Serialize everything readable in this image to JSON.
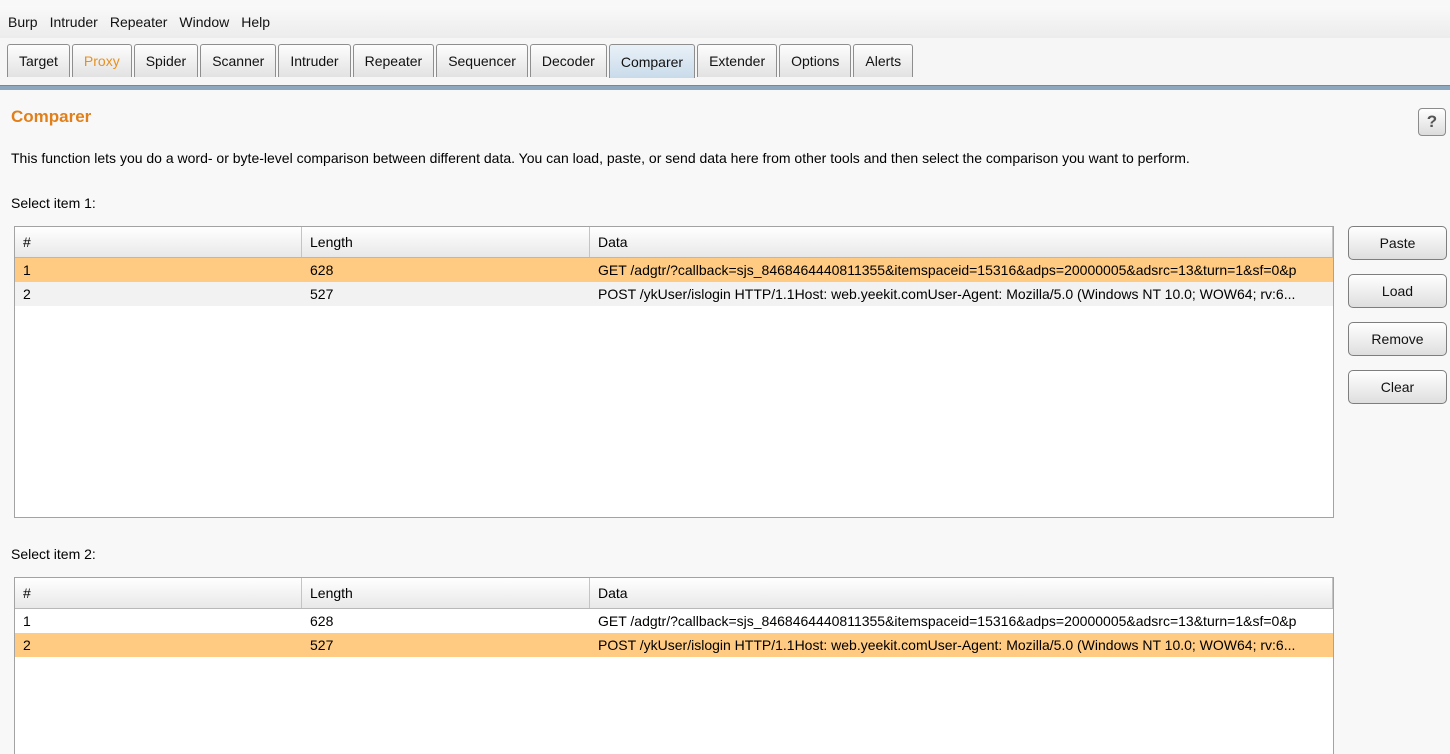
{
  "menu": [
    "Burp",
    "Intruder",
    "Repeater",
    "Window",
    "Help"
  ],
  "tabs": [
    "Target",
    "Proxy",
    "Spider",
    "Scanner",
    "Intruder",
    "Repeater",
    "Sequencer",
    "Decoder",
    "Comparer",
    "Extender",
    "Options",
    "Alerts"
  ],
  "active_tab": "Comparer",
  "highlight_tab": "Proxy",
  "colors": {
    "accent": "#e1801a",
    "selection": "#ffcb83",
    "tab_active": "#c9dbea"
  },
  "page": {
    "title": "Comparer",
    "help_label": "?",
    "description": "This function lets you do a word- or byte-level comparison between different data. You can load, paste, or send data here from other tools and then select the comparison you want to perform."
  },
  "select1": {
    "label": "Select item 1:"
  },
  "select2": {
    "label": "Select item 2:"
  },
  "table": {
    "headers": [
      "#",
      "Length",
      "Data"
    ],
    "rows": [
      {
        "num": "1",
        "length": "628",
        "data": "GET /adgtr/?callback=sjs_8468464440811355&itemspaceid=15316&adps=20000005&adsrc=13&turn=1&sf=0&p"
      },
      {
        "num": "2",
        "length": "527",
        "data": "POST /ykUser/islogin HTTP/1.1Host: web.yeekit.comUser-Agent: Mozilla/5.0 (Windows NT 10.0; WOW64; rv:6..."
      }
    ]
  },
  "buttons": {
    "paste": "Paste",
    "load": "Load",
    "remove": "Remove",
    "clear": "Clear"
  }
}
